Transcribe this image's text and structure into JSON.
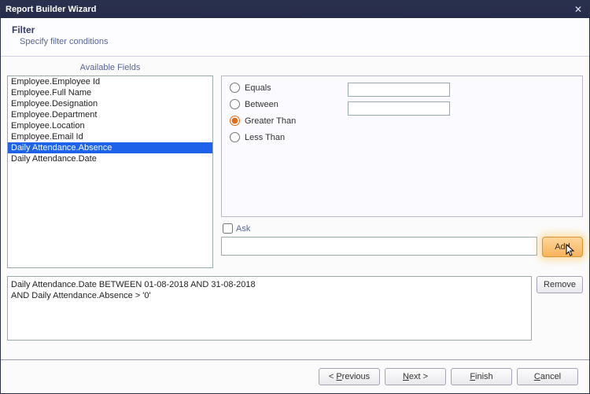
{
  "window": {
    "title": "Report Builder Wizard"
  },
  "header": {
    "title": "Filter",
    "subtitle": "Specify filter conditions"
  },
  "available_fields": {
    "label": "Available Fields",
    "items": [
      {
        "label": "Employee.Employee Id",
        "selected": false
      },
      {
        "label": "Employee.Full Name",
        "selected": false
      },
      {
        "label": "Employee.Designation",
        "selected": false
      },
      {
        "label": "Employee.Department",
        "selected": false
      },
      {
        "label": "Employee.Location",
        "selected": false
      },
      {
        "label": "Employee.Email Id",
        "selected": false
      },
      {
        "label": "Daily Attendance.Absence",
        "selected": true
      },
      {
        "label": "Daily Attendance.Date",
        "selected": false
      }
    ]
  },
  "conditions": {
    "options": {
      "equals": "Equals",
      "between": "Between",
      "greater_than": "Greater Than",
      "less_than": "Less Than"
    },
    "selected": "greater_than",
    "value1": "",
    "value2": ""
  },
  "ask": {
    "label": "Ask",
    "checked": false
  },
  "expression": "",
  "buttons": {
    "add": "Add",
    "remove": "Remove"
  },
  "results": "Daily Attendance.Date BETWEEN 01-08-2018 AND 31-08-2018\nAND Daily Attendance.Absence > '0'",
  "footer": {
    "previous": "< Previous",
    "next": "Next >",
    "finish": "Finish",
    "cancel": "Cancel"
  }
}
